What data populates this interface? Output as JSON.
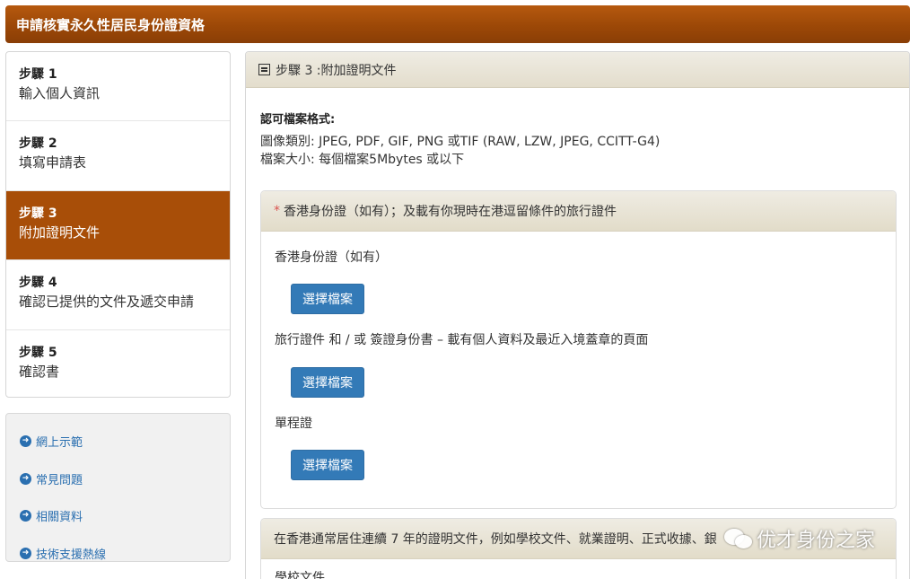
{
  "header": {
    "title": "申請核實永久性居民身份證資格"
  },
  "steps": [
    {
      "num": "步驟 1",
      "desc": "輸入個人資訊"
    },
    {
      "num": "步驟 2",
      "desc": "填寫申請表"
    },
    {
      "num": "步驟 3",
      "desc": "附加證明文件"
    },
    {
      "num": "步驟 4",
      "desc": "確認已提供的文件及遞交申請"
    },
    {
      "num": "步驟 5",
      "desc": "確認書"
    }
  ],
  "active_step": 3,
  "links": [
    {
      "label": "網上示範"
    },
    {
      "label": "常見問題"
    },
    {
      "label": "相關資料"
    },
    {
      "label": "技術支援熱線"
    }
  ],
  "main": {
    "title": "步驟 3 :附加證明文件",
    "formats": {
      "label": "認可檔案格式:",
      "image_types": "圖像類別:  JPEG, PDF, GIF, PNG 或TIF (RAW, LZW, JPEG, CCITT-G4)",
      "file_size": "檔案大小:  每個檔案5Mbytes 或以下"
    },
    "section1": {
      "required_mark": "*",
      "title": "香港身份證（如有）；及載有你現時在港逗留條件的旅行證件",
      "fields": [
        {
          "label": "香港身份證（如有）",
          "button": "選擇檔案"
        },
        {
          "label": "旅行證件 和 / 或 簽證身份書 – 載有個人資料及最近入境蓋章的頁面",
          "button": "選擇檔案"
        },
        {
          "label": "單程證",
          "button": "選擇檔案"
        }
      ]
    },
    "section2": {
      "title": "在香港通常居住連續 7 年的證明文件，例如學校文件、就業證明、正式收據、銀",
      "first_field": "學校文件"
    }
  },
  "watermark": {
    "text": "优才身份之家",
    "icon": "wechat-icon"
  },
  "colors": {
    "header_brown": "#9c4807",
    "active_step": "#a84e08",
    "button_blue": "#337ab7",
    "link_blue": "#2a6fb0",
    "required_red": "#d9534f"
  }
}
